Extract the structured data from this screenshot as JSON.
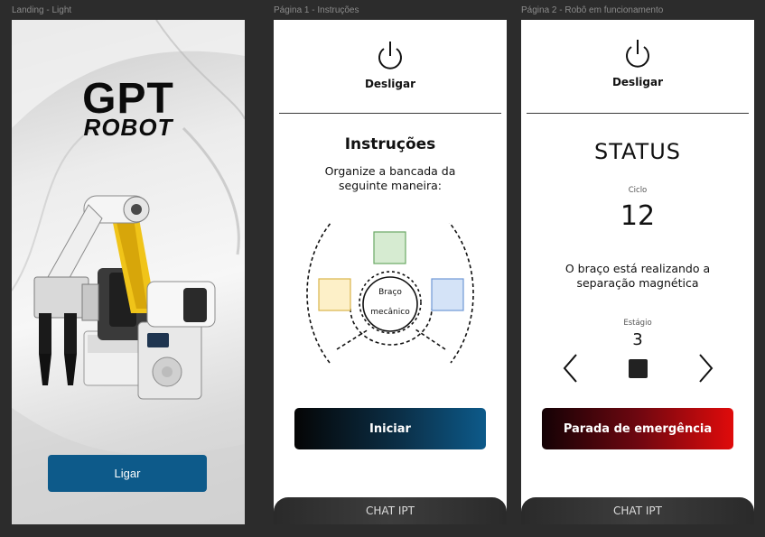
{
  "frames": {
    "landing_label": "Landing - Light",
    "page1_label": "Página 1 - Instruções",
    "page2_label": "Página 2 - Robô em funcionamento"
  },
  "landing": {
    "logo_line1": "GPT",
    "logo_line2": "ROBOT",
    "button_label": "Ligar"
  },
  "page1": {
    "power_label": "Desligar",
    "title": "Instruções",
    "instructions": "Organize a bancada da seguinte maneira:",
    "diagram": {
      "center_line1": "Braço",
      "center_line2": "mecânico",
      "box_colors": {
        "top": "#d6ebd1",
        "left": "#fdf0c8",
        "right": "#d4e3f7"
      }
    },
    "start_button": "Iniciar",
    "chat_label": "CHAT IPT"
  },
  "page2": {
    "power_label": "Desligar",
    "status_title": "STATUS",
    "cycle_label": "Ciclo",
    "cycle_value": "12",
    "message": "O braço está realizando a separação magnética",
    "stage_label": "Estágio",
    "stage_value": "3",
    "emergency_button": "Parada de emergência",
    "chat_label": "CHAT IPT"
  },
  "colors": {
    "ligar_button": "#0d5a8a",
    "emergency_red": "#e00b0b"
  },
  "icons": [
    "power-icon",
    "chevron-left-icon",
    "chevron-right-icon",
    "stop-icon"
  ]
}
